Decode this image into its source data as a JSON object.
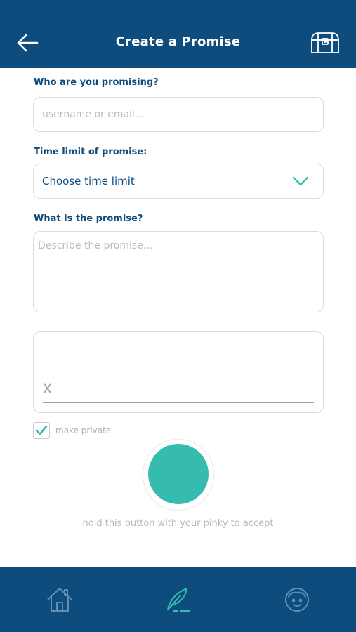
{
  "header": {
    "title": "Create a Promise",
    "back_icon": "arrow-left-icon",
    "chest_icon": "treasure-chest-icon"
  },
  "form": {
    "recipient_label": "Who are you promising?",
    "recipient_placeholder": "username or email...",
    "time_label": "Time limit of promise:",
    "time_value": "Choose time limit",
    "promise_label": "What is the promise?",
    "promise_placeholder": "Describe the promise...",
    "signature_mark": "X",
    "private_label": "make private",
    "private_checked": true,
    "hint": "hold this button with your pinky to accept"
  },
  "tabbar": {
    "items": [
      {
        "icon": "home-icon",
        "active": false
      },
      {
        "icon": "feather-pen-icon",
        "active": true
      },
      {
        "icon": "profile-face-icon",
        "active": false
      }
    ]
  },
  "colors": {
    "primary": "#0f4c7e",
    "accent": "#36bcae",
    "muted": "#b3b9be"
  }
}
